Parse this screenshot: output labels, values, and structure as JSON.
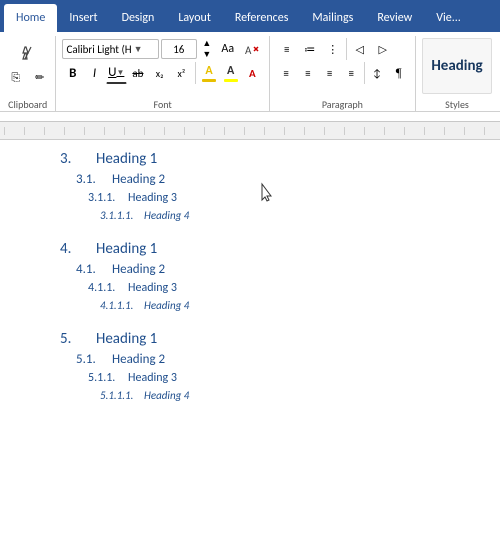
{
  "tabs": [
    {
      "label": "Home",
      "active": true
    },
    {
      "label": "Insert",
      "active": false
    },
    {
      "label": "Design",
      "active": false
    },
    {
      "label": "Layout",
      "active": false
    },
    {
      "label": "References",
      "active": false
    },
    {
      "label": "Mailings",
      "active": false
    },
    {
      "label": "Review",
      "active": false
    },
    {
      "label": "Vie...",
      "active": false
    }
  ],
  "toolbar": {
    "font_name": "Calibri Light (H",
    "font_size": "16",
    "bold_label": "B",
    "italic_label": "I",
    "underline_label": "U",
    "strikethrough_label": "ab",
    "subscript_label": "x₂",
    "superscript_label": "x²",
    "font_color_label": "A",
    "highlight_label": "A",
    "font_group_label": "Font",
    "para_group_label": "Paragraph",
    "styles_group_label": "Styles",
    "style_preview": "Heading",
    "clipboard_label": "Clipboard"
  },
  "toc": {
    "sections": [
      {
        "id": "sec3",
        "entries": [
          {
            "level": 1,
            "num": "3.",
            "text": "Heading 1"
          },
          {
            "level": 2,
            "num": "3.1.",
            "text": "Heading 2"
          },
          {
            "level": 3,
            "num": "3.1.1.",
            "text": "Heading 3"
          },
          {
            "level": 4,
            "num": "3.1.1.1.",
            "text": "Heading 4"
          }
        ]
      },
      {
        "id": "sec4",
        "entries": [
          {
            "level": 1,
            "num": "4.",
            "text": "Heading 1"
          },
          {
            "level": 2,
            "num": "4.1.",
            "text": "Heading 2"
          },
          {
            "level": 3,
            "num": "4.1.1.",
            "text": "Heading 3"
          },
          {
            "level": 4,
            "num": "4.1.1.1.",
            "text": "Heading 4"
          }
        ]
      },
      {
        "id": "sec5",
        "entries": [
          {
            "level": 1,
            "num": "5.",
            "text": "Heading 1"
          },
          {
            "level": 2,
            "num": "5.1.",
            "text": "Heading 2"
          },
          {
            "level": 3,
            "num": "5.1.1.",
            "text": "Heading 3"
          },
          {
            "level": 4,
            "num": "5.1.1.1.",
            "text": "Heading 4"
          }
        ]
      }
    ]
  },
  "colors": {
    "accent": "#2b579a",
    "text_blue": "#1f4e8c",
    "tab_active_bg": "#ffffff",
    "ribbon_bg": "#2b579a",
    "font_color_bar": "#e8c000",
    "highlight_bar": "#ffff00"
  }
}
